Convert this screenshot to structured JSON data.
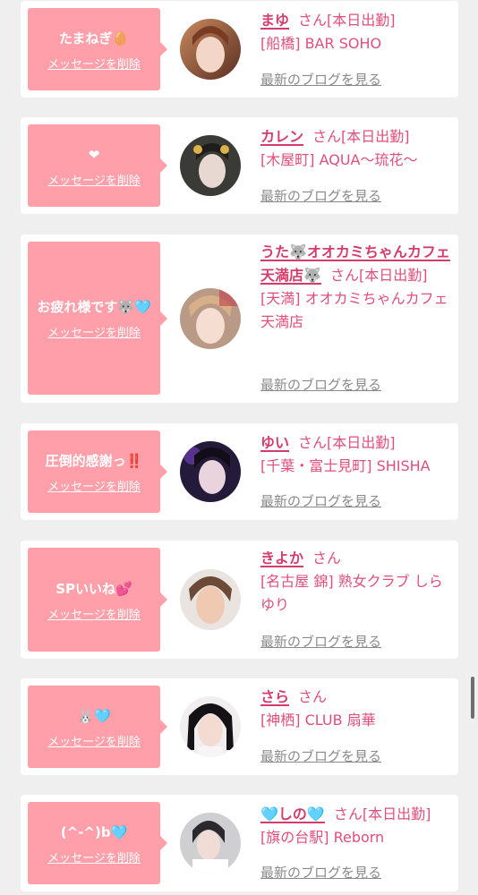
{
  "honorific": "さん",
  "blog_link_label": "最新のブログを見る",
  "delete_label": "メッセージを削除",
  "cards": [
    {
      "message": "たまねぎ🥚",
      "name": "まゆ",
      "status": "[本日出勤]",
      "area_shop": "[船橋] BAR SOHO"
    },
    {
      "message": "❤",
      "name": "カレン",
      "status": "[本日出勤]",
      "area_shop": "[木屋町] AQUA〜琉花〜"
    },
    {
      "message": "お疲れ様です🐺🩵",
      "name": "うた🐺オオカミちゃんカフェ天満店🐺",
      "status": "[本日出勤]",
      "area_shop": "[天満] オオカミちゃんカフェ天満店"
    },
    {
      "message": "圧倒的感謝っ‼️",
      "name": "ゆい",
      "status": "[本日出勤]",
      "area_shop": "[千葉・富士見町] SHISHA"
    },
    {
      "message": "SPいいね💕",
      "name": "きよか",
      "status": "",
      "area_shop": "[名古屋 錦] 熟女クラブ しらゆり"
    },
    {
      "message": "🐰🩵",
      "name": "さら",
      "status": "",
      "area_shop": "[神栖] CLUB 扇華"
    },
    {
      "message": "(^-^)b🩵",
      "name": "🩵しの🩵",
      "status": "[本日出勤]",
      "area_shop": "[旗の台駅] Reborn"
    }
  ],
  "colors": {
    "page_bg": "#efefef",
    "bubble_bg": "#ff9fa9",
    "name_text": "#d43d6b",
    "info_text": "#e04f79",
    "link_gray": "#8a8a8a"
  },
  "icons": [
    "avatar-photo"
  ]
}
